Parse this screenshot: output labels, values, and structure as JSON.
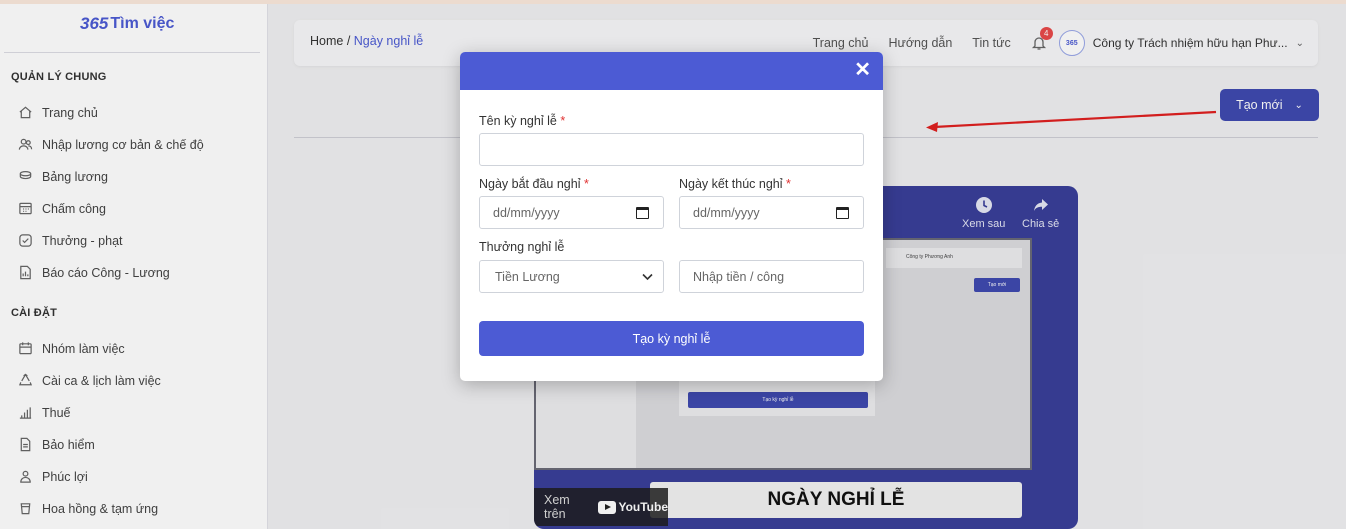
{
  "logo": {
    "mark": "365",
    "text": "Tìm việc"
  },
  "sidebar": {
    "section1": "QUẢN LÝ CHUNG",
    "items1": [
      {
        "label": "Trang chủ",
        "icon": "home-icon"
      },
      {
        "label": "Nhập lương cơ bản & chế độ",
        "icon": "users-icon"
      },
      {
        "label": "Bảng lương",
        "icon": "coins-icon"
      },
      {
        "label": "Chấm công",
        "icon": "calendar-grid-icon"
      },
      {
        "label": "Thưởng - phạt",
        "icon": "check-circle-icon"
      },
      {
        "label": "Báo cáo Công - Lương",
        "icon": "report-icon"
      }
    ],
    "section2": "CÀI ĐẶT",
    "items2": [
      {
        "label": "Nhóm làm việc",
        "icon": "calendar-icon"
      },
      {
        "label": "Cài ca & lịch làm việc",
        "icon": "recycle-icon"
      },
      {
        "label": "Thuế",
        "icon": "bar-chart-icon"
      },
      {
        "label": "Bảo hiểm",
        "icon": "document-icon"
      },
      {
        "label": "Phúc lợi",
        "icon": "group-icon"
      },
      {
        "label": "Hoa hồng & tạm ứng",
        "icon": "cup-icon"
      }
    ]
  },
  "topbar": {
    "breadcrumb_home": "Home / ",
    "breadcrumb_current": "Ngày nghỉ lễ",
    "nav": [
      "Trang chủ",
      "Hướng dẫn",
      "Tin tức"
    ],
    "notification_count": "4",
    "company": "Công ty Trách nhiệm hữu hạn Phư...",
    "avatar_text": "365"
  },
  "create_button": "Tạo mới",
  "video": {
    "watch_later": "Xem sau",
    "share": "Chia sẻ",
    "banner": "NGÀY NGHỈ LỄ",
    "watch_on": "Xem trên",
    "youtube": "YouTube",
    "mini_company": "Công ty Phương Anh",
    "mini_create": "Tạo mới",
    "mini_submit": "Tạo kỳ nghỉ lễ"
  },
  "modal": {
    "name_label": "Tên kỳ nghỉ lễ",
    "name_value": "",
    "start_label": "Ngày bắt đầu nghỉ",
    "start_placeholder": "dd/mm/yyyy",
    "end_label": "Ngày kết thúc nghỉ",
    "end_placeholder": "dd/mm/yyyy",
    "bonus_label": "Thưởng nghỉ lễ",
    "bonus_type_selected": "Tiền Lương",
    "bonus_amount_placeholder": "Nhập tiền / công",
    "submit": "Tạo kỳ nghỉ lễ",
    "required_mark": "*"
  },
  "colors": {
    "primary": "#4c5bd4",
    "button_dark": "#3f4ab0",
    "required": "#e03030"
  }
}
